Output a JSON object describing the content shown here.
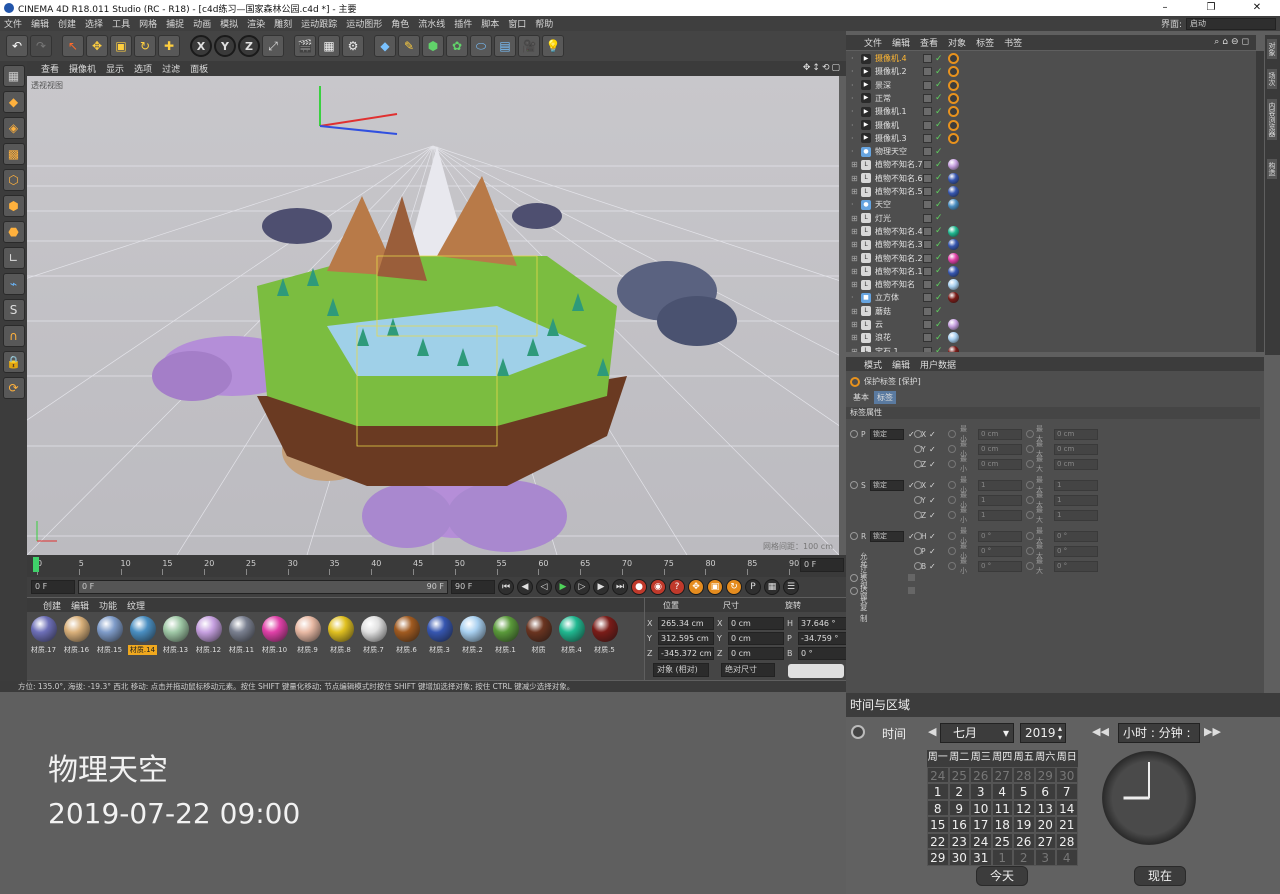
{
  "app": {
    "title": "CINEMA 4D R18.011 Studio (RC - R18) - [c4d练习—国家森林公园.c4d *] - 主要",
    "layout_label": "界面:",
    "layout_value": "启动"
  },
  "menu": [
    "文件",
    "编辑",
    "创建",
    "选择",
    "工具",
    "网格",
    "捕捉",
    "动画",
    "模拟",
    "渲染",
    "雕刻",
    "运动跟踪",
    "运动图形",
    "角色",
    "流水线",
    "插件",
    "脚本",
    "窗口",
    "帮助"
  ],
  "viewport": {
    "menu": [
      "查看",
      "摄像机",
      "显示",
      "选项",
      "过滤",
      "面板"
    ],
    "camera_label": "透视视图",
    "grid_scale": "网格间距：100 cm"
  },
  "timeline": {
    "ticks": [
      "0",
      "5",
      "10",
      "15",
      "20",
      "25",
      "30",
      "35",
      "40",
      "45",
      "50",
      "55",
      "60",
      "65",
      "70",
      "75",
      "80",
      "85",
      "90"
    ],
    "current_frame_field": "0 F",
    "start_field": "0 F",
    "range_start": "0 F",
    "range_end": "90 F",
    "end_field": "90 F"
  },
  "materials": {
    "menu": [
      "创建",
      "编辑",
      "功能",
      "纹理"
    ],
    "items": [
      {
        "label": "材质.17",
        "color": "#6d6fb8"
      },
      {
        "label": "材质.16",
        "color": "#d9b07a"
      },
      {
        "label": "材质.15",
        "color": "#7f9cc9"
      },
      {
        "label": "材质.14",
        "color": "#4a8fc2",
        "selected": true
      },
      {
        "label": "材质.13",
        "color": "#9fc8a6"
      },
      {
        "label": "材质.12",
        "color": "#c6a0e0"
      },
      {
        "label": "材质.11",
        "color": "#7a8090"
      },
      {
        "label": "材质.10",
        "color": "#e040a8"
      },
      {
        "label": "材质.9",
        "color": "#e8b9a4"
      },
      {
        "label": "材质.8",
        "color": "#e0c020"
      },
      {
        "label": "材质.7",
        "color": "#e0e0e0"
      },
      {
        "label": "材质.6",
        "color": "#a05a20"
      },
      {
        "label": "材质.3",
        "color": "#3656b0"
      },
      {
        "label": "材质.2",
        "color": "#a8d0f0"
      },
      {
        "label": "材质.1",
        "color": "#5a9a3a"
      },
      {
        "label": "材质",
        "color": "#6a3420"
      },
      {
        "label": "材质.4",
        "color": "#20b890"
      },
      {
        "label": "材质.5",
        "color": "#7a1c18"
      }
    ]
  },
  "coords": {
    "headers": [
      "位置",
      "尺寸",
      "旋转"
    ],
    "rows": [
      {
        "axis": "X",
        "pos": "265.34 cm",
        "size_axis": "X",
        "size": "0 cm",
        "rot_axis": "H",
        "rot": "37.646 °"
      },
      {
        "axis": "Y",
        "pos": "312.595 cm",
        "size_axis": "Y",
        "size": "0 cm",
        "rot_axis": "P",
        "rot": "-34.759 °"
      },
      {
        "axis": "Z",
        "pos": "-345.372 cm",
        "size_axis": "Z",
        "size": "0 cm",
        "rot_axis": "B",
        "rot": "0 °"
      }
    ],
    "mode1": "对象 (相对)",
    "mode2": "绝对尺寸"
  },
  "status": {
    "text": "方位: 135.0°, 海拔: -19.3° 西北    移动: 点击并拖动鼠标移动元素。按住 SHIFT 键量化移动; 节点编辑模式时按住 SHIFT 键增加选择对象; 按住 CTRL 键减少选择对象。"
  },
  "overlay": {
    "title": "物理天空",
    "datetime": "2019-07-22  09:00"
  },
  "objects": {
    "menu": [
      "文件",
      "编辑",
      "查看",
      "对象",
      "标签",
      "书签"
    ],
    "items": [
      {
        "name": "摄像机.4",
        "icon": "camera",
        "tag": "protect",
        "highlight": true
      },
      {
        "name": "摄像机.2",
        "icon": "camera",
        "tag": "protect"
      },
      {
        "name": "景深",
        "icon": "camera",
        "tag": "protect"
      },
      {
        "name": "正常",
        "icon": "camera",
        "tag": "protect"
      },
      {
        "name": "摄像机.1",
        "icon": "camera",
        "tag": "protect"
      },
      {
        "name": "摄像机",
        "icon": "camera",
        "tag": "protect"
      },
      {
        "name": "摄像机.3",
        "icon": "camera",
        "tag": "protect"
      },
      {
        "name": "物理天空",
        "icon": "sky",
        "tag": "none"
      },
      {
        "name": "植物不知名.7",
        "icon": "null",
        "tag": "#c6a0e0"
      },
      {
        "name": "植物不知名.6",
        "icon": "null",
        "tag": "#3656b0"
      },
      {
        "name": "植物不知名.5",
        "icon": "null",
        "tag": "#3656b0"
      },
      {
        "name": "天空",
        "icon": "sky",
        "tag": "#4a8fc2"
      },
      {
        "name": "灯光",
        "icon": "null",
        "tag": "none"
      },
      {
        "name": "植物不知名.4",
        "icon": "null",
        "tag": "#20b890"
      },
      {
        "name": "植物不知名.3",
        "icon": "null",
        "tag": "#3656b0"
      },
      {
        "name": "植物不知名.2",
        "icon": "null",
        "tag": "#e040a8"
      },
      {
        "name": "植物不知名.1",
        "icon": "null",
        "tag": "#3656b0"
      },
      {
        "name": "植物不知名",
        "icon": "null",
        "tag": "#a8d0f0"
      },
      {
        "name": "立方体",
        "icon": "cube",
        "tag": "#7a1c18"
      },
      {
        "name": "蘑菇",
        "icon": "null",
        "tag": "none"
      },
      {
        "name": "云",
        "icon": "null",
        "tag": "#c6a0e0"
      },
      {
        "name": "浪花",
        "icon": "null",
        "tag": "#a8d0f0"
      },
      {
        "name": "宝石.1",
        "icon": "null",
        "tag": "#7a1c18"
      }
    ]
  },
  "attributes": {
    "menu": [
      "模式",
      "编辑",
      "用户数据"
    ],
    "title": "保护标签 [保护]",
    "tabs": [
      "基本",
      "标签"
    ],
    "section": "标签属性",
    "groups": [
      {
        "label": "P",
        "mode": "锁定",
        "axes": [
          "X",
          "Y",
          "Z"
        ],
        "min_label": "最小",
        "min": "0 cm",
        "max_label": "最大",
        "max": "0 cm"
      },
      {
        "label": "S",
        "mode": "锁定",
        "axes": [
          "X",
          "Y",
          "Z"
        ],
        "min_label": "最小",
        "min": "1",
        "max_label": "最大",
        "max": "1"
      },
      {
        "label": "R",
        "mode": "锁定",
        "axes": [
          "H",
          "P",
          "B"
        ],
        "min_label": "最小",
        "min": "0 °",
        "max_label": "最大",
        "max": "0 °"
      }
    ],
    "opt1": "允许表达式",
    "opt2": "允许视窗复制"
  },
  "right_tabs": [
    "对象",
    "场次",
    "内容浏览器",
    "构造"
  ],
  "time_region": {
    "title": "时间与区域",
    "time_label": "时间",
    "month": "七月",
    "year": "2019",
    "clock_field": "小时 : 分钟 :",
    "weekdays": [
      "周一",
      "周二",
      "周三",
      "周四",
      "周五",
      "周六",
      "周日"
    ],
    "weeks": [
      [
        {
          "d": "24",
          "dim": true
        },
        {
          "d": "25",
          "dim": true
        },
        {
          "d": "26",
          "dim": true
        },
        {
          "d": "27",
          "dim": true
        },
        {
          "d": "28",
          "dim": true
        },
        {
          "d": "29",
          "dim": true
        },
        {
          "d": "30",
          "dim": true
        }
      ],
      [
        {
          "d": "1"
        },
        {
          "d": "2"
        },
        {
          "d": "3"
        },
        {
          "d": "4"
        },
        {
          "d": "5"
        },
        {
          "d": "6"
        },
        {
          "d": "7"
        }
      ],
      [
        {
          "d": "8"
        },
        {
          "d": "9"
        },
        {
          "d": "10"
        },
        {
          "d": "11"
        },
        {
          "d": "12"
        },
        {
          "d": "13"
        },
        {
          "d": "14"
        }
      ],
      [
        {
          "d": "15"
        },
        {
          "d": "16"
        },
        {
          "d": "17"
        },
        {
          "d": "18"
        },
        {
          "d": "19"
        },
        {
          "d": "20"
        },
        {
          "d": "21"
        }
      ],
      [
        {
          "d": "22"
        },
        {
          "d": "23"
        },
        {
          "d": "24"
        },
        {
          "d": "25"
        },
        {
          "d": "26"
        },
        {
          "d": "27"
        },
        {
          "d": "28"
        }
      ],
      [
        {
          "d": "29"
        },
        {
          "d": "30"
        },
        {
          "d": "31"
        },
        {
          "d": "1",
          "dim": true
        },
        {
          "d": "2",
          "dim": true
        },
        {
          "d": "3",
          "dim": true
        },
        {
          "d": "4",
          "dim": true
        }
      ]
    ],
    "today_button": "今天",
    "now_button": "现在",
    "clock_hour": 9,
    "clock_minute": 0
  }
}
